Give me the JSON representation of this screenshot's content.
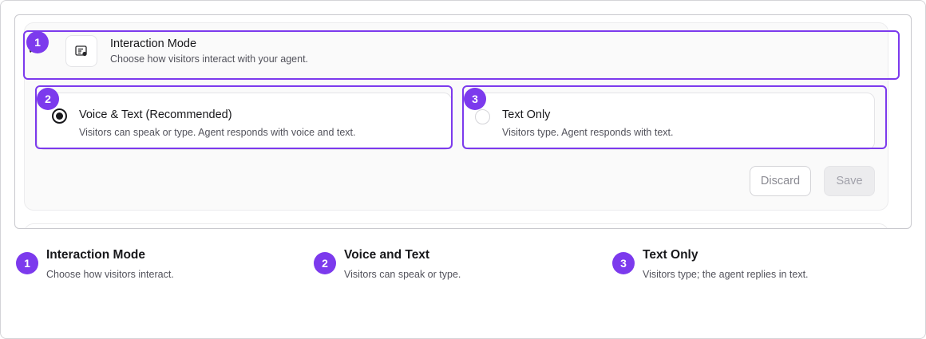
{
  "settings": {
    "interaction_mode": {
      "title": "Interaction Mode",
      "description": "Choose how visitors interact with your agent.",
      "icon": "document-settings-icon",
      "expanded_icon": "check-icon"
    },
    "options": [
      {
        "label": "Voice & Text (Recommended)",
        "description": "Visitors can speak or type. Agent responds with voice and text.",
        "selected": true
      },
      {
        "label": "Text Only",
        "description": "Visitors type. Agent responds with text.",
        "selected": false
      }
    ],
    "actions": {
      "discard": "Discard",
      "save": "Save",
      "save_disabled": true
    }
  },
  "annotations": [
    {
      "number": "1",
      "title": "Interaction Mode",
      "description": "Choose how visitors interact."
    },
    {
      "number": "2",
      "title": "Voice and Text",
      "description": "Visitors can speak or type."
    },
    {
      "number": "3",
      "title": "Text Only",
      "description": "Visitors type; the agent replies in text."
    }
  ],
  "colors": {
    "highlight": "#7c3aed",
    "text": "#18181b",
    "muted": "#52525b",
    "border": "#e4e4e7"
  }
}
